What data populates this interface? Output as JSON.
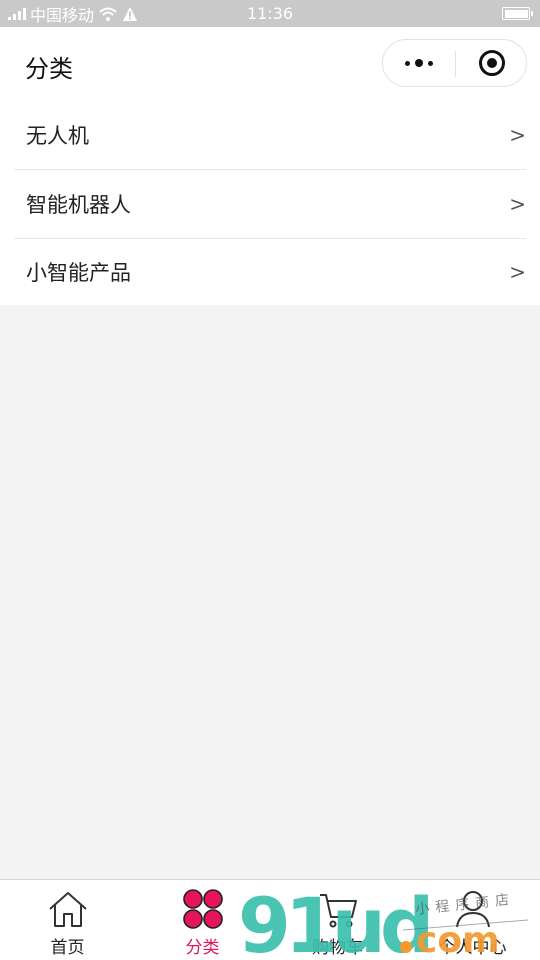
{
  "status_bar": {
    "carrier": "中国移动",
    "time": "11:36",
    "battery_level": 1.0,
    "icons": [
      "signal-icon",
      "wifi-icon",
      "warning-icon",
      "battery-icon"
    ]
  },
  "nav": {
    "title": "分类",
    "capsule": {
      "more_icon": "more-dots-icon",
      "close_icon": "target-circle-icon"
    }
  },
  "categories": [
    {
      "label": "无人机",
      "chevron": ">"
    },
    {
      "label": "智能机器人",
      "chevron": ">"
    },
    {
      "label": "小智能产品",
      "chevron": ">"
    }
  ],
  "tab_bar": {
    "active_color": "#e6145c",
    "items": [
      {
        "label": "首页",
        "icon": "home-icon",
        "active": false
      },
      {
        "label": "分类",
        "icon": "clover-icon",
        "active": true
      },
      {
        "label": "购物车",
        "icon": "cart-icon",
        "active": false
      },
      {
        "label": "个人中心",
        "icon": "user-icon",
        "active": false
      }
    ]
  },
  "watermark": {
    "text": "91ud.com",
    "script": "小程序商店"
  },
  "colors": {
    "status_bar_bg": "#c9c9c9",
    "page_bg": "#f3f3f3",
    "watermark_teal": "#3bbfad",
    "watermark_orange": "#f29a2e"
  }
}
